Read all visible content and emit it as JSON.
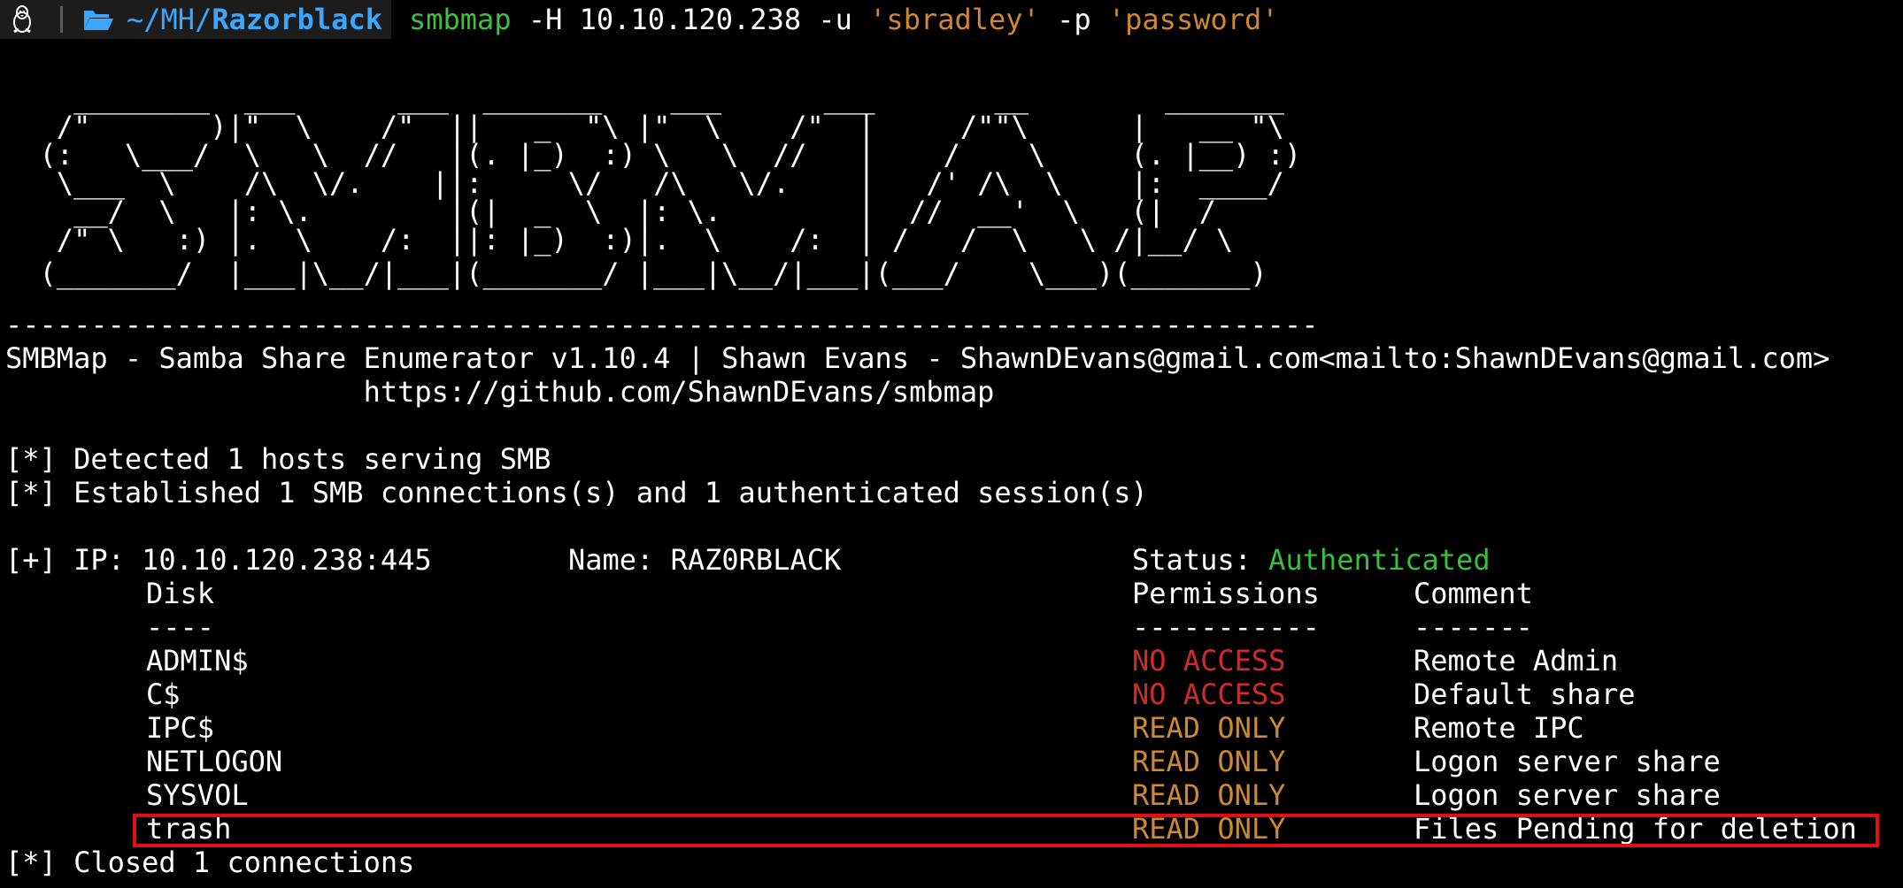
{
  "prompt": {
    "os_icon": "tux-icon",
    "folder_icon": "folder-open-icon",
    "path_base": "~/MH/",
    "path_dir": "Razorblack",
    "command": "smbmap",
    "args1": " -H 10.10.120.238 -u ",
    "user_arg": "'sbradley'",
    "args2": " -p ",
    "pass_arg": "'password'"
  },
  "banner": [
    "    ________  ___      ___  _______    ___      ___       __        _______",
    "   /\"       )|\"  \\    /\"  ||   _  \"\\ |\"  \\    /\"  |     /\"\"\\      |   __ \"\\",
    "  (:   \\___/  \\   \\  //   |(. |_)  :) \\   \\  //   |    /    \\     (. |__) :)",
    "   \\___  \\    /\\  \\/.    ||:     \\/   /\\   \\/.    |   /' /\\  \\    |:  ____/",
    "    __/  \\   |: \\.        |(|  _  \\  |: \\.        |  //  __'  \\   (|  /",
    "   /\" \\   :) |.  \\    /:  ||: |_)  :)|.  \\    /:  | /   /  \\   \\ /|__/ \\",
    "  (_______/  |___|\\__/|___|(_______/ |___|\\__/|___|(___/    \\___)(_______)"
  ],
  "divider": "-----------------------------------------------------------------------------",
  "info_line1": "SMBMap - Samba Share Enumerator v1.10.4 | Shawn Evans - ShawnDEvans@gmail.com<mailto:ShawnDEvans@gmail.com>",
  "info_line2": "                     https://github.com/ShawnDEvans/smbmap",
  "status1": "[*] Detected 1 hosts serving SMB",
  "status2": "[*] Established 1 SMB connections(s) and 1 authenticated session(s)",
  "host": {
    "ip_label": "[+] IP: 10.10.120.238:445",
    "name_label": "Name: RAZ0RBLACK",
    "status_label": "Status: ",
    "status_value": "Authenticated"
  },
  "table": {
    "headers": {
      "disk": "Disk",
      "permissions": "Permissions",
      "comment": "Comment"
    },
    "underlines": {
      "disk": "----",
      "permissions": "-----------",
      "comment": "-------"
    },
    "rows": [
      {
        "disk": "ADMIN$",
        "permissions": "NO ACCESS",
        "comment": "Remote Admin",
        "perm_color": "#d12a2a"
      },
      {
        "disk": "C$",
        "permissions": "NO ACCESS",
        "comment": "Default share",
        "perm_color": "#d12a2a"
      },
      {
        "disk": "IPC$",
        "permissions": "READ ONLY",
        "comment": "Remote IPC",
        "perm_color": "#d0872f"
      },
      {
        "disk": "NETLOGON",
        "permissions": "READ ONLY",
        "comment": "Logon server share",
        "perm_color": "#d0872f"
      },
      {
        "disk": "SYSVOL",
        "permissions": "READ ONLY",
        "comment": "Logon server share",
        "perm_color": "#d0872f"
      },
      {
        "disk": "trash",
        "permissions": "READ ONLY",
        "comment": "Files Pending for deletion",
        "perm_color": "#d0872f",
        "highlighted": true
      }
    ]
  },
  "closing": "[*] Closed 1 connections",
  "colors": {
    "background": "#000000",
    "command": "#3ec13e",
    "string_arg": "#d0872f",
    "path": "#3aa7ff",
    "no_access": "#d12a2a",
    "read_only": "#d0872f",
    "authenticated": "#36c13a",
    "highlight_box": "#e10f0f"
  }
}
